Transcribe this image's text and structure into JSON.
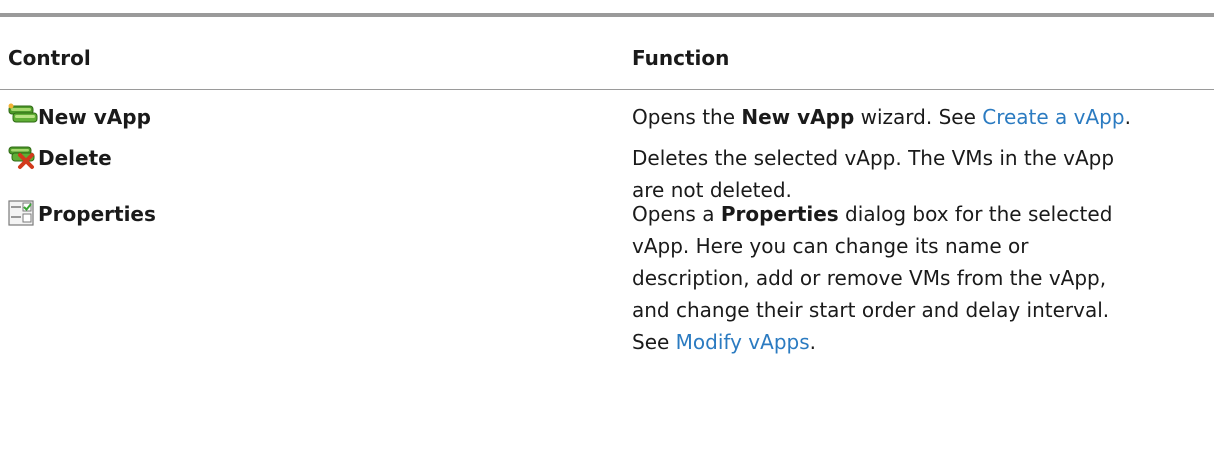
{
  "table": {
    "headers": {
      "control": "Control",
      "function": "Function"
    },
    "rows": [
      {
        "icon": "new-vapp-icon",
        "control": "New vApp",
        "function": {
          "lines": [
            {
              "before": "Opens the ",
              "bold": "New vApp",
              "after": " wizard. See ",
              "link": "Create a vApp",
              "end": "."
            }
          ]
        }
      },
      {
        "icon": "delete-vapp-icon",
        "control": "Delete",
        "function": {
          "lines": [
            "Deletes the selected vApp. The VMs in the vApp",
            "are not deleted."
          ]
        }
      },
      {
        "icon": "properties-icon",
        "control": "Properties",
        "function": {
          "line1": {
            "before": "Opens a ",
            "bold": "Properties",
            "after": " dialog box for the selected"
          },
          "lines": [
            "vApp. Here you can change its name or",
            "description, add or remove VMs from the vApp,",
            "and change their start order and delay interval."
          ],
          "last": {
            "before": "See ",
            "link": "Modify vApps",
            "end": "."
          }
        }
      }
    ]
  }
}
